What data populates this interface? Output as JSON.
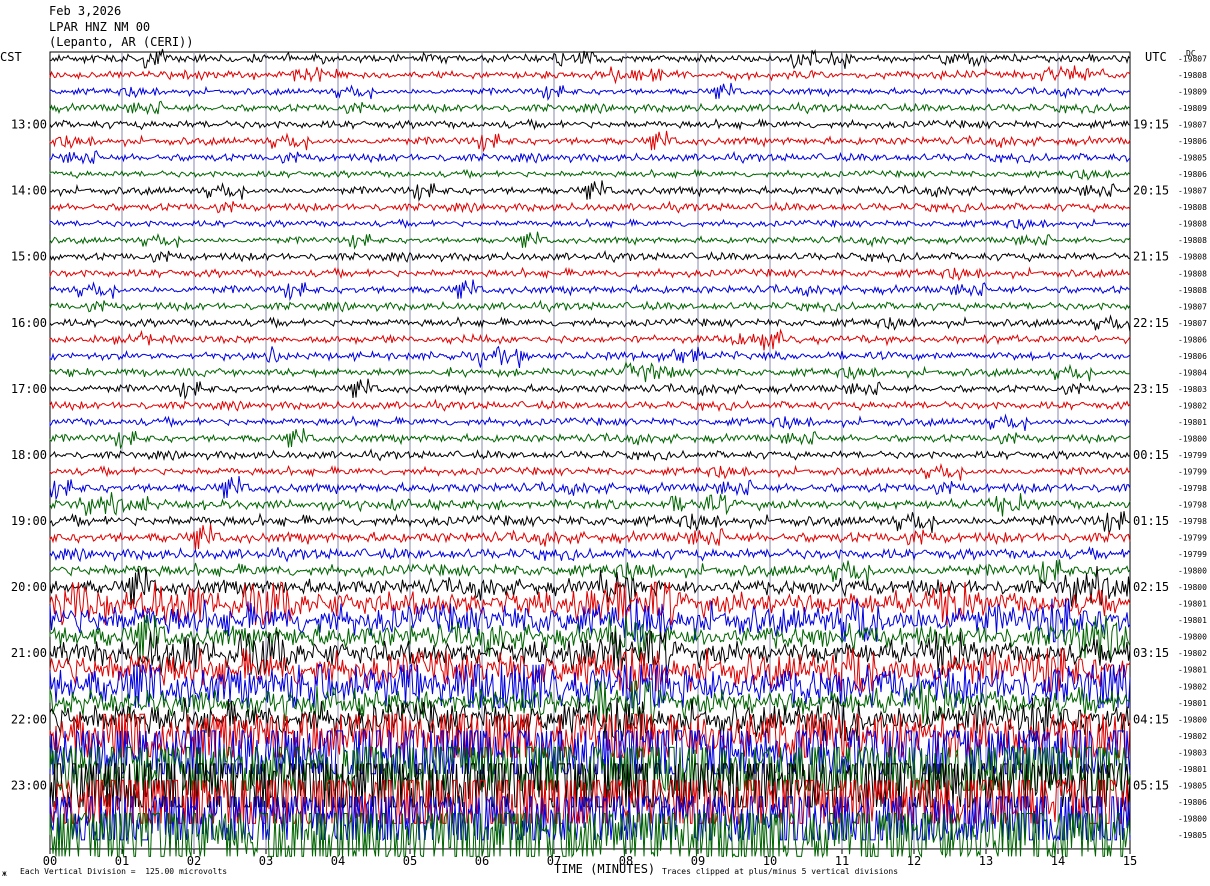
{
  "header": {
    "date": "Feb 3,2026",
    "station": "LPAR HNZ NM 00",
    "location": "(Lepanto, AR (CERI))"
  },
  "left_tz": "CST",
  "right_tz": "UTC",
  "dc_label": "DC",
  "footer": {
    "scale_note": "Each Vertical Division =  125.00 microvolts",
    "clip_note": "Traces clipped at plus/minus 5 vertical divisions",
    "corner_mark": "ж"
  },
  "colors": {
    "trace_cycle": [
      "#000000",
      "#e00000",
      "#0000e0",
      "#006400"
    ],
    "grid": "#8a8ab0"
  },
  "chart_data": {
    "type": "line",
    "title": "LPAR HNZ NM 00",
    "xlabel": "TIME (MINUTES)",
    "ylabel": "",
    "x_ticks": [
      "00",
      "01",
      "02",
      "03",
      "04",
      "05",
      "06",
      "07",
      "08",
      "09",
      "10",
      "11",
      "12",
      "13",
      "14",
      "15"
    ],
    "xlim": [
      0,
      15
    ],
    "left_hour_labels": [
      "13:00",
      "14:00",
      "15:00",
      "16:00",
      "17:00",
      "18:00",
      "19:00",
      "20:00",
      "21:00",
      "22:00",
      "23:00"
    ],
    "right_hour_labels": [
      "19:15",
      "20:15",
      "21:15",
      "22:15",
      "23:15",
      "00:15",
      "01:15",
      "02:15",
      "03:15",
      "04:15",
      "05:15"
    ],
    "row_dc_offsets": [
      "-19807",
      "-19808",
      "-19809",
      "-19809",
      "-19807",
      "-19806",
      "-19805",
      "-19806",
      "-19807",
      "-19808",
      "-19808",
      "-19808",
      "-19808",
      "-19808",
      "-19808",
      "-19807",
      "-19807",
      "-19806",
      "-19806",
      "-19804",
      "-19803",
      "-19802",
      "-19801",
      "-19800",
      "-19799",
      "-19799",
      "-19798",
      "-19798",
      "-19798",
      "-19799",
      "-19799",
      "-19800",
      "-19800",
      "-19801",
      "-19801",
      "-19800",
      "-19802",
      "-19801",
      "-19802",
      "-19801",
      "-19800",
      "-19802",
      "-19803",
      "-19801",
      "-19805",
      "-19806",
      "-19800",
      "-19805"
    ],
    "row_amplitude_divisions": [
      0.3,
      0.3,
      0.25,
      0.3,
      0.3,
      0.3,
      0.3,
      0.25,
      0.3,
      0.3,
      0.25,
      0.25,
      0.3,
      0.3,
      0.3,
      0.3,
      0.3,
      0.3,
      0.3,
      0.3,
      0.3,
      0.3,
      0.3,
      0.3,
      0.3,
      0.3,
      0.35,
      0.35,
      0.4,
      0.4,
      0.4,
      0.45,
      0.6,
      0.9,
      1.2,
      0.9,
      0.9,
      1.4,
      1.6,
      1.0,
      1.3,
      2.4,
      3.5,
      4.0,
      5.0,
      4.5,
      3.5,
      4.0
    ],
    "grid": true,
    "scale_microvolts_per_division": 125.0,
    "clip_divisions": 5
  }
}
